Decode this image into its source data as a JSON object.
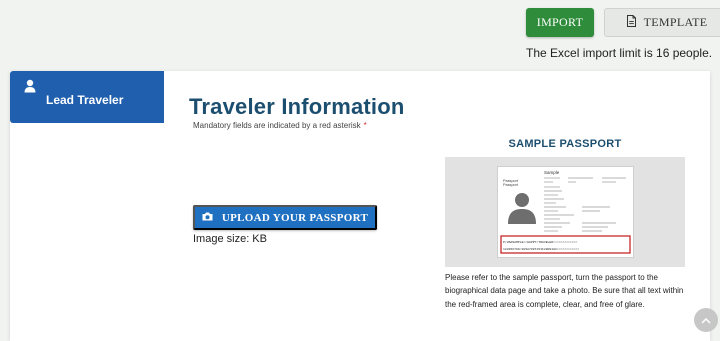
{
  "toolbar": {
    "import_label": "IMPORT",
    "template_label": "TEMPLATE",
    "import_note": "The Excel import limit is 16 people."
  },
  "sidebar": {
    "active_item": {
      "label": "Lead Traveler",
      "icon": "person-icon"
    }
  },
  "main": {
    "title": "Traveler Information",
    "mandatory_note": "Mandatory fields are indicated by a red asterisk",
    "mandatory_star": "*",
    "upload_button_label": "UPLOAD YOUR PASSPORT",
    "image_size_text": "Image size: KB"
  },
  "sample": {
    "title": "SAMPLE PASSPORT",
    "passport_heading": "Sample",
    "passport_word": "Passport",
    "mrz_line_1": "P<USASAMPLE<<HAPPY<TRAVELER<<<<<<<<<<<<<",
    "mrz_line_2": "123456789<1USA7007154F2009102<<<<<<<<<<<<",
    "description": "Please refer to the sample passport, turn the passport to the biographical data page and take a photo. Be sure that all text within the red-framed area is complete, clear, and free of glare."
  },
  "colors": {
    "primary": "#1f5fae",
    "upload": "#1f70c1",
    "import": "#2e8c3a",
    "title": "#1c4e6f",
    "asterisk": "#d32f2f",
    "mrz_frame": "#c62828"
  }
}
